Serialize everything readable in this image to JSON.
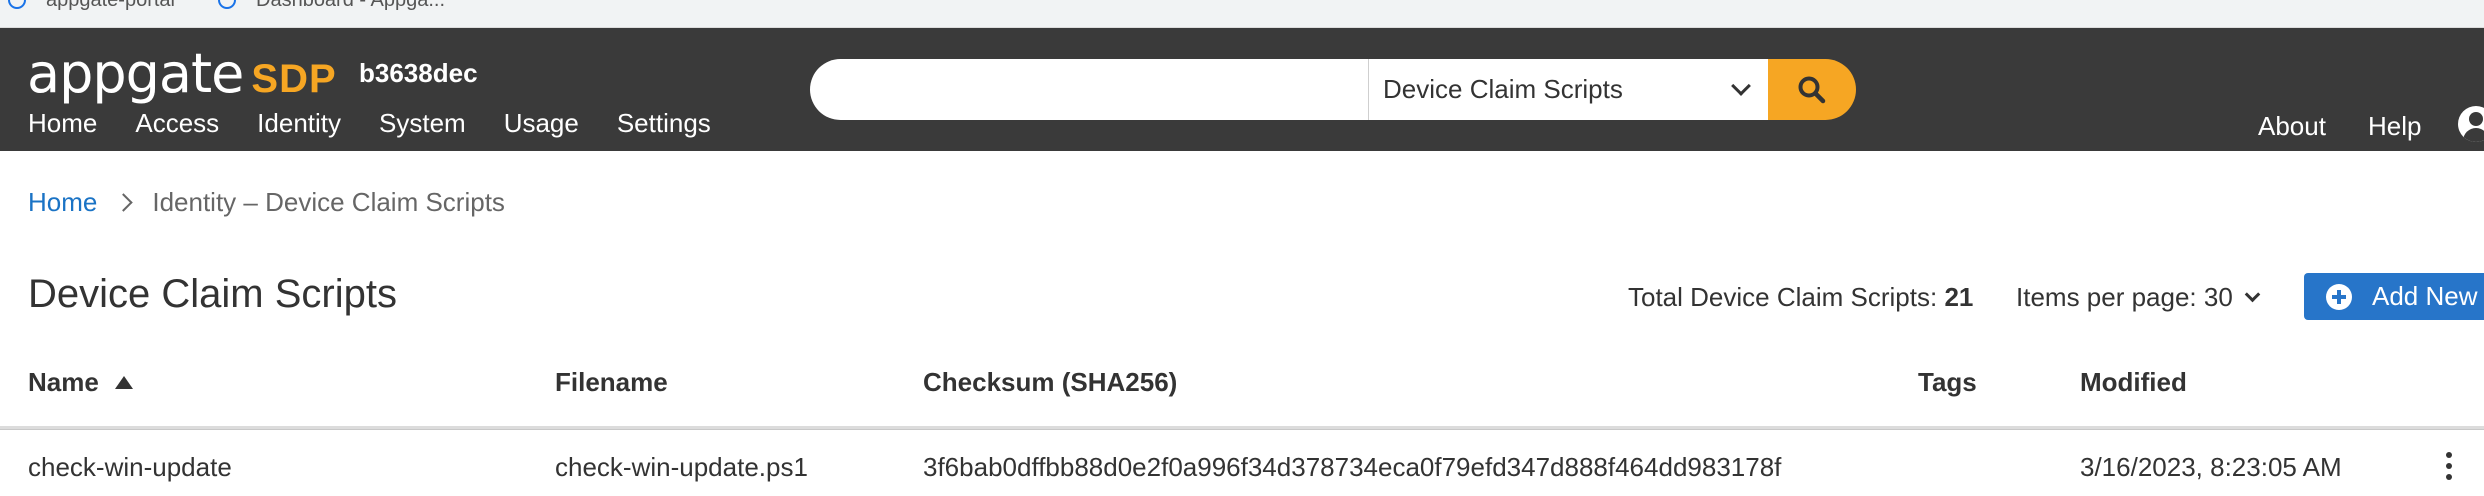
{
  "browser_tabs": [
    {
      "label": "appgate-portal"
    },
    {
      "label": "Dashboard - Appga..."
    }
  ],
  "header": {
    "logo_word": "appgate",
    "logo_sdp": "SDP",
    "tenant": "b3638dec",
    "nav": [
      "Home",
      "Access",
      "Identity",
      "System",
      "Usage",
      "Settings"
    ],
    "search": {
      "value": "",
      "scope": "Device Claim Scripts"
    },
    "right_nav": {
      "about": "About",
      "help": "Help"
    }
  },
  "breadcrumb": {
    "home": "Home",
    "current": "Identity – Device Claim Scripts"
  },
  "page": {
    "title": "Device Claim Scripts",
    "total_label": "Total Device Claim Scripts:",
    "total_count": "21",
    "items_per_page": "Items per page: 30",
    "add_new": "Add New"
  },
  "table": {
    "columns": [
      "Name",
      "Filename",
      "Checksum (SHA256)",
      "Tags",
      "Modified"
    ],
    "rows": [
      {
        "name": "check-win-update",
        "filename": "check-win-update.ps1",
        "checksum": "3f6bab0dffbb88d0e2f0a996f34d378734eca0f79efd347d888f464dd983178f",
        "tags": "",
        "modified": "3/16/2023, 8:23:05 AM"
      }
    ]
  },
  "colors": {
    "header_bg": "#3a3a3a",
    "accent_orange": "#f6a623",
    "primary_blue": "#2775c9",
    "link_blue": "#1a73c5"
  }
}
